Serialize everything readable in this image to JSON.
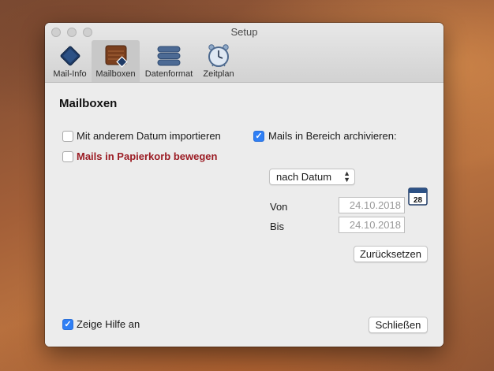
{
  "window": {
    "title": "Setup"
  },
  "toolbar": {
    "tabs": [
      {
        "label": "Mail-Info",
        "icon": "diamond-icon"
      },
      {
        "label": "Mailboxen",
        "icon": "mailbox-icon"
      },
      {
        "label": "Datenformat",
        "icon": "database-icon"
      },
      {
        "label": "Zeitplan",
        "icon": "clock-icon"
      }
    ],
    "selected": "Mailboxen"
  },
  "main": {
    "heading": "Mailboxen",
    "options": {
      "import_other_date": {
        "label": "Mit anderem Datum importieren",
        "checked": false
      },
      "move_to_trash": {
        "label": "Mails in Papierkorb bewegen",
        "checked": false
      },
      "archive_in_range": {
        "label": "Mails in Bereich archivieren:",
        "checked": true
      }
    },
    "sort_select": {
      "value": "nach Datum"
    },
    "range": {
      "from_label": "Von",
      "from_value": "24.10.2018",
      "to_label": "Bis",
      "to_value": "24.10.2018",
      "calendar_day": "28"
    },
    "reset_button": "Zurücksetzen"
  },
  "footer": {
    "show_help": {
      "label": "Zeige Hilfe an",
      "checked": true
    },
    "close_button": "Schließen"
  },
  "colors": {
    "accent": "#2f7ff5",
    "warning_text": "#9b1c24"
  }
}
